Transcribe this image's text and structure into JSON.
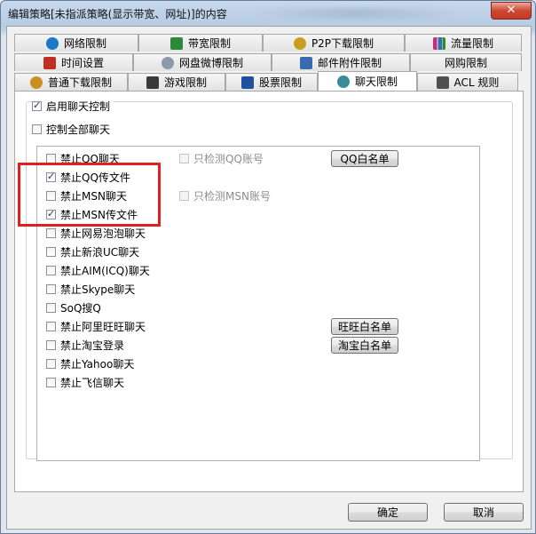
{
  "window": {
    "title": "编辑策略[未指派策略(显示带宽、网址)]的内容",
    "close_glyph": "✕"
  },
  "tabs": {
    "row1": [
      {
        "label": "网络限制",
        "icon": "ie-icon",
        "color": "#1e78c8"
      },
      {
        "label": "带宽限制",
        "icon": "monitor-icon",
        "color": "#2a8a3a"
      },
      {
        "label": "P2P下载限制",
        "icon": "p2p-icon",
        "color": "#c8a020"
      },
      {
        "label": "流量限制",
        "icon": "bar-chart-icon",
        "color": "#c03080"
      }
    ],
    "row2": [
      {
        "label": "时间设置",
        "icon": "clock-icon",
        "color": "#c03020"
      },
      {
        "label": "网盘微博限制",
        "icon": "cloud-icon",
        "color": "#8a9aa8"
      },
      {
        "label": "邮件附件限制",
        "icon": "mail-icon",
        "color": "#3a6ab0"
      },
      {
        "label": "网购限制",
        "icon": "",
        "color": ""
      }
    ],
    "row3": [
      {
        "label": "普通下载限制",
        "icon": "download-icon",
        "color": "#c89020"
      },
      {
        "label": "游戏限制",
        "icon": "game-icon",
        "color": "#3a3a3a"
      },
      {
        "label": "股票限制",
        "icon": "stock-icon",
        "color": "#2050a0"
      },
      {
        "label": "聊天限制",
        "icon": "chat-icon",
        "color": "#3a8a9a",
        "active": true
      },
      {
        "label": "ACL 规则",
        "icon": "acl-icon",
        "color": "#505050"
      }
    ]
  },
  "chat": {
    "enable_label": "启用聊天控制",
    "enable_checked": true,
    "control_all_label": "控制全部聊天",
    "control_all_checked": false,
    "items": [
      {
        "label": "禁止QQ聊天",
        "checked": false
      },
      {
        "label": "禁止QQ传文件",
        "checked": true
      },
      {
        "label": "禁止MSN聊天",
        "checked": false
      },
      {
        "label": "禁止MSN传文件",
        "checked": true
      },
      {
        "label": "禁止网易泡泡聊天",
        "checked": false
      },
      {
        "label": "禁止新浪UC聊天",
        "checked": false
      },
      {
        "label": "禁止AIM(ICQ)聊天",
        "checked": false
      },
      {
        "label": "禁止Skype聊天",
        "checked": false
      },
      {
        "label": "SoQ搜Q",
        "checked": false
      },
      {
        "label": "禁止阿里旺旺聊天",
        "checked": false
      },
      {
        "label": "禁止淘宝登录",
        "checked": false
      },
      {
        "label": "禁止Yahoo聊天",
        "checked": false
      },
      {
        "label": "禁止飞信聊天",
        "checked": false
      }
    ],
    "only_qq_label": "只检测QQ账号",
    "only_msn_label": "只检测MSN账号",
    "qq_whitelist": "QQ白名单",
    "wangwang_whitelist": "旺旺白名单",
    "taobao_whitelist": "淘宝白名单"
  },
  "footer": {
    "ok": "确定",
    "cancel": "取消"
  },
  "colors": {
    "highlight": "#e02020"
  }
}
